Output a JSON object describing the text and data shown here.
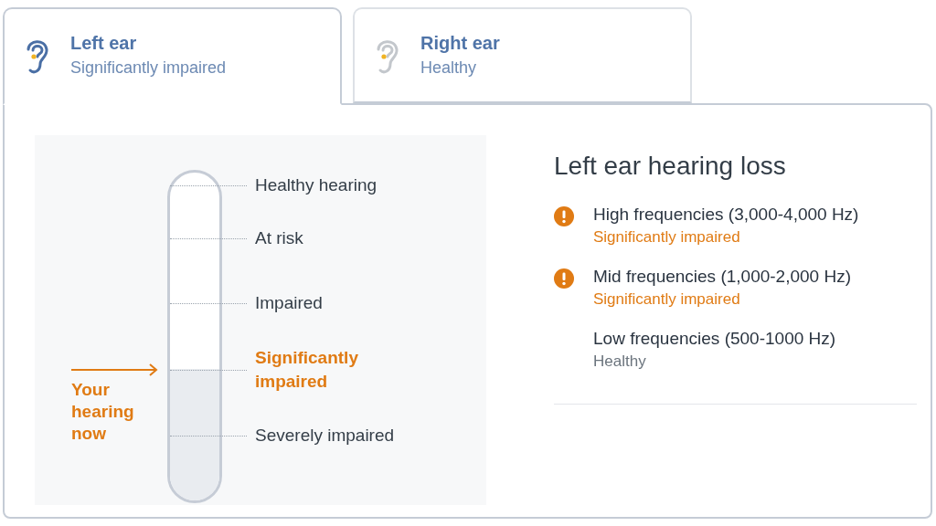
{
  "tabs": [
    {
      "title": "Left ear",
      "status": "Significantly impaired",
      "selected": true
    },
    {
      "title": "Right ear",
      "status": "Healthy",
      "selected": false
    }
  ],
  "gauge": {
    "level": 0.4,
    "pointer_label": "Your hearing now",
    "marks": [
      {
        "label": "Healthy hearing",
        "selected": false
      },
      {
        "label": "At risk",
        "selected": false
      },
      {
        "label": "Impaired",
        "selected": false
      },
      {
        "label": "Significantly impaired",
        "selected": true
      },
      {
        "label": "Severely impaired",
        "selected": false
      }
    ]
  },
  "summary": {
    "title": "Left ear hearing loss",
    "frequencies": [
      {
        "name": "High frequencies (3,000-4,000 Hz)",
        "status": "Significantly impaired",
        "alert": true
      },
      {
        "name": "Mid frequencies (1,000-2,000 Hz)",
        "status": "Significantly impaired",
        "alert": true
      },
      {
        "name": "Low frequencies (500-1000 Hz)",
        "status": "Healthy",
        "alert": false
      }
    ]
  }
}
